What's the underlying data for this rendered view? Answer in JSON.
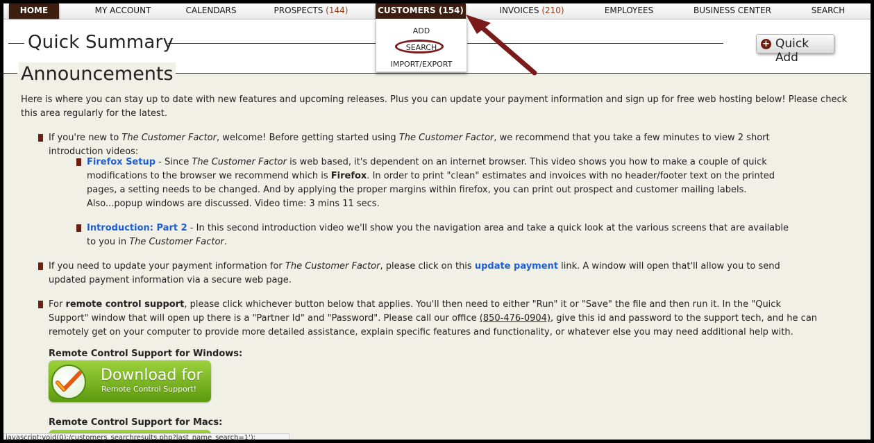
{
  "nav": {
    "items": [
      {
        "label": "HOME",
        "count": ""
      },
      {
        "label": "MY ACCOUNT",
        "count": ""
      },
      {
        "label": "CALENDARS",
        "count": ""
      },
      {
        "label": "PROSPECTS",
        "count": "(144)"
      },
      {
        "label": "CUSTOMERS",
        "count": "(154)"
      },
      {
        "label": "INVOICES",
        "count": "(210)"
      },
      {
        "label": "EMPLOYEES",
        "count": ""
      },
      {
        "label": "BUSINESS CENTER",
        "count": ""
      },
      {
        "label": "SEARCH",
        "count": ""
      }
    ],
    "dropdown": [
      "ADD",
      "SEARCH",
      "IMPORT/EXPORT"
    ]
  },
  "header": {
    "title": "Quick Summary",
    "quick_add": "Quick Add"
  },
  "announcements": {
    "title": "Announcements",
    "intro": "Here is where you can stay up to date with new features and upcoming releases. Plus you can update your payment information and sign up for free web hosting below! Please check this area regularly for the latest.",
    "new_user": {
      "p1": "If you're new to ",
      "brand": "The Customer Factor",
      "p2": ", welcome! Before getting started using ",
      "p3": ", we recommend that you take a few minutes to view 2 short introduction videos:"
    },
    "firefox": {
      "link": "Firefox Setup",
      "p1": " - Since ",
      "p2": " is web based, it's dependent on an internet browser. This video shows you how to make a couple of quick modifications to the browser we recommend which is ",
      "bold": "Firefox",
      "p3": ". In order to print \"clean\" estimates and invoices with no header/footer text on the printed pages, a setting needs to be changed. And by applying the proper margins within firefox, you can print out prospect and customer mailing labels. Also...popup windows are discussed. Video time: 3 mins 11 secs."
    },
    "intro2": {
      "link": "Introduction: Part 2",
      "p1": " - In this second introduction video we'll show you the navigation area and take a quick look at the various screens that are available to you in ",
      "p2": "."
    },
    "payment": {
      "p1": "If you need to update your payment information for ",
      "p2": ", please click on this ",
      "link": "update payment",
      "p3": " link. A window will open that'll allow you to send updated payment information via a secure web page."
    },
    "remote": {
      "p1": "For ",
      "bold": "remote control support",
      "p2": ", please click whichever button below that applies. You'll then need to either \"Run\" it or \"Save\" the file and then run it. In the \"Quick Support\" window that will open up there is a \"Partner Id\" and \"Password\". Please call our office ",
      "phone": "(850-476-0904)",
      "p3": ", give this id and password to the support tech, and he can remotely get on your computer to provide more detailed assistance, explain specific features and functionality, or whatever else you may need additional help with."
    },
    "windows_label": "Remote Control Support for Windows:",
    "download_big": "Download for",
    "download_small": "Remote Control Support!",
    "mac_label": "Remote Control Support for Macs:"
  },
  "status_bar": "javascript:void(0);/customers_searchresults.php?last_name_search=1');",
  "colors": {
    "accent": "#3d1e10",
    "bullet": "#6b2010",
    "link": "#1f5fd6",
    "arrow": "#7a1a1a"
  }
}
